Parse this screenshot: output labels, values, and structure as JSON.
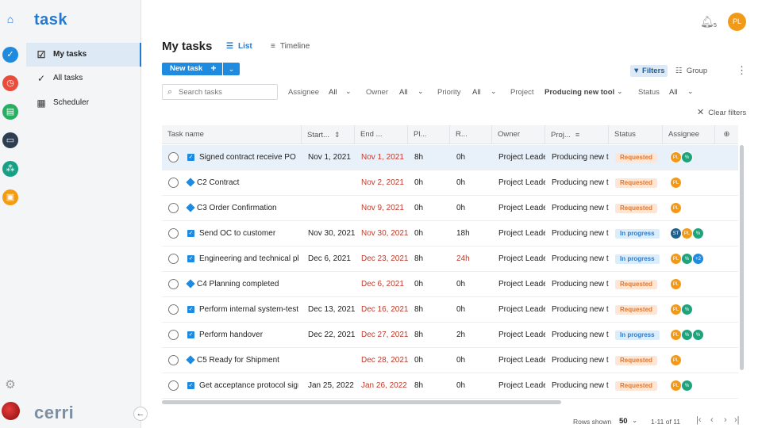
{
  "app": {
    "logo": "task",
    "brand": "cerri"
  },
  "rail": {
    "colors": {
      "blue": "#1f8be0",
      "red": "#e74c3c",
      "green": "#27ae60",
      "dark": "#2c3e50",
      "teal": "#16a085",
      "orange": "#f39c12"
    },
    "icons": [
      "home-icon",
      "check-circle-icon",
      "timer-icon",
      "clipboard-icon",
      "folder-icon",
      "team-icon",
      "briefcase-icon",
      "settings-icon"
    ]
  },
  "sidebar": {
    "items": [
      {
        "label": "My tasks",
        "icon": "my-tasks-icon",
        "active": true
      },
      {
        "label": "All tasks",
        "icon": "check-circle-icon",
        "active": false
      },
      {
        "label": "Scheduler",
        "icon": "calendar-icon",
        "active": false
      }
    ]
  },
  "header": {
    "title": "My tasks",
    "tabs": {
      "list": "List",
      "timeline": "Timeline"
    },
    "notifications": "5",
    "user_initials": "PL"
  },
  "toolbar": {
    "new_task": "New task",
    "filters": "Filters",
    "group": "Group"
  },
  "filters": {
    "search_placeholder": "Search tasks",
    "assignee": {
      "label": "Assignee",
      "value": "All"
    },
    "owner": {
      "label": "Owner",
      "value": "All"
    },
    "priority": {
      "label": "Priority",
      "value": "All"
    },
    "project": {
      "label": "Project",
      "value": "Producing new tool"
    },
    "status": {
      "label": "Status",
      "value": "All"
    },
    "clear": "Clear filters"
  },
  "table": {
    "columns": {
      "name": "Task name",
      "start": "Start...",
      "end": "End ...",
      "planned": "Pl...",
      "remaining": "R...",
      "owner": "Owner",
      "project": "Proj...",
      "status": "Status",
      "assignee": "Assignee"
    },
    "rows": [
      {
        "name": "Signed contract receive PO",
        "type": "task",
        "start": "Nov 1, 2021",
        "end": "Nov 1, 2021",
        "planned": "8h",
        "remaining": "0h",
        "owner": "Project Leader",
        "project": "Producing new tool",
        "status": "Requested",
        "assignees": [
          "PL",
          "%"
        ]
      },
      {
        "name": "C2 Contract",
        "type": "milestone",
        "start": "",
        "end": "Nov 2, 2021",
        "planned": "0h",
        "remaining": "0h",
        "owner": "Project Leader",
        "project": "Producing new tool",
        "status": "Requested",
        "assignees": [
          "PL"
        ]
      },
      {
        "name": "C3 Order Confirmation",
        "type": "milestone",
        "start": "",
        "end": "Nov 9, 2021",
        "planned": "0h",
        "remaining": "0h",
        "owner": "Project Leader",
        "project": "Producing new tool",
        "status": "Requested",
        "assignees": [
          "PL"
        ]
      },
      {
        "name": "Send OC to customer",
        "type": "task",
        "start": "Nov 30, 2021",
        "end": "Nov 30, 2021",
        "planned": "0h",
        "remaining": "18h",
        "owner": "Project Leader",
        "project": "Producing new tool",
        "status": "In progress",
        "assignees": [
          "ST",
          "PL",
          "%"
        ]
      },
      {
        "name": "Engineering and technical planning",
        "type": "task",
        "start": "Dec 6, 2021",
        "end": "Dec 23, 2021",
        "planned": "8h",
        "remaining": "24h",
        "owner": "Project Leader",
        "project": "Producing new tool",
        "status": "In progress",
        "assignees": [
          "PL",
          "%",
          "+2"
        ]
      },
      {
        "name": "C4 Planning completed",
        "type": "milestone",
        "start": "",
        "end": "Dec 6, 2021",
        "planned": "0h",
        "remaining": "0h",
        "owner": "Project Leader",
        "project": "Producing new tool",
        "status": "Requested",
        "assignees": [
          "PL"
        ]
      },
      {
        "name": "Perform internal system-test",
        "type": "task",
        "start": "Dec 13, 2021",
        "end": "Dec 16, 2021",
        "planned": "8h",
        "remaining": "0h",
        "owner": "Project Leader",
        "project": "Producing new tool",
        "status": "Requested",
        "assignees": [
          "PL",
          "%"
        ]
      },
      {
        "name": "Perform handover",
        "type": "task",
        "start": "Dec 22, 2021",
        "end": "Dec 27, 2021",
        "planned": "8h",
        "remaining": "2h",
        "owner": "Project Leader",
        "project": "Producing new tool",
        "status": "In progress",
        "assignees": [
          "PL",
          "%",
          "%"
        ]
      },
      {
        "name": "C5 Ready for Shipment",
        "type": "milestone",
        "start": "",
        "end": "Dec 28, 2021",
        "planned": "0h",
        "remaining": "0h",
        "owner": "Project Leader",
        "project": "Producing new tool",
        "status": "Requested",
        "assignees": [
          "PL"
        ]
      },
      {
        "name": "Get acceptance protocol signed",
        "type": "task",
        "start": "Jan 25, 2022",
        "end": "Jan 26, 2022",
        "planned": "8h",
        "remaining": "0h",
        "owner": "Project Leader",
        "project": "Producing new tool",
        "status": "Requested",
        "assignees": [
          "PL",
          "%"
        ]
      }
    ]
  },
  "avatar_colors": {
    "PL": "#f19a1a",
    "%": "#1fa37a",
    "ST": "#1e5f8c",
    "+2": "#1f8be0"
  },
  "pagination": {
    "rows_label": "Rows shown",
    "rows_value": "50",
    "range": "1-11 of 11"
  }
}
